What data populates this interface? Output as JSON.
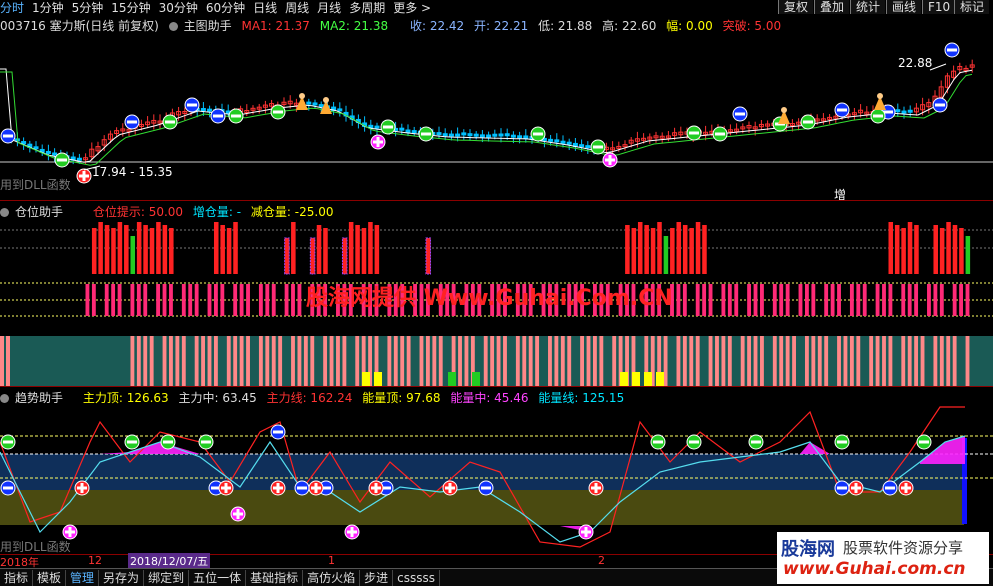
{
  "topbar": {
    "periods": [
      "分时",
      "1分钟",
      "5分钟",
      "15分钟",
      "30分钟",
      "60分钟",
      "日线",
      "周线",
      "月线",
      "多周期",
      "更多 >"
    ],
    "active_period": 0,
    "right_buttons": [
      "复权",
      "叠加",
      "统计",
      "画线",
      "F10",
      "标记"
    ]
  },
  "main": {
    "stock": "003716 塞力斯(日线 前复权)",
    "indicator": "主图助手",
    "ma1_label": "MA1: 21.37",
    "ma2_label": "MA2: 21.38",
    "close": "收: 22.42",
    "open": "开: 22.21",
    "low": "低: 21.88",
    "high": "高: 22.60",
    "amp": "幅: 0.00",
    "break": "突破: 5.00",
    "high_price_label": "22.88",
    "low_price_label": "17.94 - 15.35",
    "dll_note": "用到DLL函数",
    "zeng_label": "增"
  },
  "position": {
    "title": "仓位助手",
    "hint": "仓位提示: 50.00",
    "add": "增仓量: -",
    "reduce": "减仓量: -25.00",
    "watermark": "股海网提供 Www.Guhai.Com.CN",
    "top_bars": [
      0,
      0,
      0,
      0,
      0,
      0,
      0,
      0,
      0,
      0,
      0,
      0,
      0,
      0,
      1,
      1,
      1,
      1,
      1,
      1,
      2,
      1,
      1,
      1,
      1,
      1,
      1,
      0,
      0,
      0,
      0,
      0,
      0,
      1,
      1,
      1,
      1,
      0,
      0,
      0,
      0,
      0,
      0,
      0,
      3,
      1,
      0,
      0,
      3,
      1,
      1,
      0,
      0,
      3,
      1,
      1,
      1,
      1,
      1,
      0,
      0,
      0,
      0,
      0,
      0,
      0,
      3,
      0,
      0,
      0,
      0,
      0,
      0,
      0,
      0,
      0,
      0,
      0,
      0,
      0,
      0,
      0,
      0,
      0,
      0,
      0,
      0,
      0,
      0,
      0,
      0,
      0,
      0,
      0,
      0,
      0,
      0,
      1,
      1,
      1,
      1,
      1,
      1,
      2,
      1,
      1,
      1,
      1,
      1,
      1,
      0,
      0,
      0,
      0,
      0,
      0,
      0,
      0,
      0,
      0,
      0,
      0,
      0,
      0,
      0,
      0,
      0,
      0,
      0,
      0,
      0,
      0,
      0,
      0,
      0,
      0,
      0,
      0,
      1,
      1,
      1,
      1,
      1,
      0,
      0,
      1,
      1,
      1,
      1,
      1,
      2
    ],
    "mid_bars": [
      0,
      0,
      0,
      0,
      0,
      0,
      0,
      0,
      0,
      0,
      0,
      0,
      0,
      1,
      1,
      1,
      1,
      1,
      1,
      1,
      1,
      1,
      1,
      1,
      1,
      1,
      1,
      1,
      1,
      1,
      1,
      1,
      1,
      1,
      1,
      1,
      1,
      1,
      1,
      1,
      1,
      1,
      1,
      1,
      1,
      1,
      1,
      1,
      1,
      1,
      1,
      1,
      1,
      1,
      1,
      1,
      1,
      1,
      1,
      1,
      1,
      1,
      1,
      1,
      1,
      1,
      1,
      1,
      1,
      1,
      1,
      1,
      1,
      1,
      1,
      1,
      1,
      1,
      1,
      1,
      1,
      1,
      1,
      1,
      1,
      1,
      1,
      1,
      1,
      1,
      1,
      1,
      1,
      1,
      1,
      1,
      1,
      1,
      1,
      1,
      1,
      1,
      1,
      1,
      1,
      1,
      1,
      1,
      1,
      1,
      1,
      1,
      1,
      1,
      1,
      1,
      1,
      1,
      1,
      1,
      1,
      1,
      1,
      1,
      1,
      1,
      1,
      1,
      1,
      1,
      1,
      1,
      1,
      1,
      1,
      1,
      1,
      1,
      1,
      1,
      1,
      1,
      1,
      1,
      1,
      1,
      1,
      1,
      1,
      1,
      1,
      1,
      1,
      1,
      1,
      1,
      1,
      1
    ]
  },
  "trend": {
    "title": "趋势助手",
    "main_top": "主力顶: 126.63",
    "main_mid": "主力中: 63.45",
    "main_line": "主力线: 162.24",
    "energy_top": "能量顶: 97.68",
    "energy_mid": "能量中: 45.46",
    "energy_line": "能量线: 125.15",
    "dll_note": "用到DLL函数"
  },
  "timeline": {
    "year_label": "2018年",
    "month_label": "12",
    "date_label": "2018/12/07/五",
    "mark1": "1",
    "mark2": "2"
  },
  "bottombar": {
    "tabs": [
      "指标",
      "模板",
      "管理",
      "另存为",
      "绑定到",
      "五位一体",
      "基础指标",
      "高仿火焰",
      "步进",
      "csssss"
    ],
    "active_tab": 2
  },
  "logo": {
    "name": "股海网",
    "slogan": "股票软件资源分享",
    "url": "www.Guhai.com.cn"
  },
  "colors": {
    "up": "#ff3333",
    "down": "#00c0ff",
    "ma1": "#ffffff",
    "ma2": "#44ff44",
    "label_red": "#ff3333",
    "label_yellow": "#ffff00",
    "label_cyan": "#00e5ff",
    "label_magenta": "#ff44ff"
  }
}
